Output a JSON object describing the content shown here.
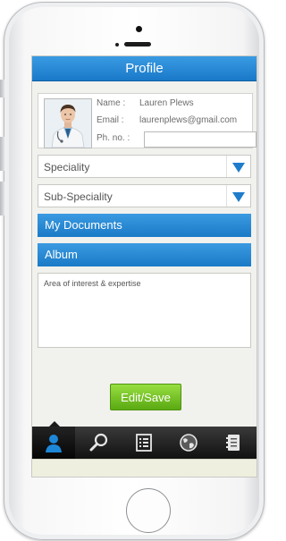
{
  "header": {
    "title": "Profile"
  },
  "profile": {
    "name_label": "Name :",
    "name_value": "Lauren Plews",
    "email_label": "Email :",
    "email_value": "laurenplews@gmail.com",
    "phone_label": "Ph. no. :",
    "phone_value": ""
  },
  "dropdowns": {
    "speciality": "Speciality",
    "sub_speciality": "Sub-Speciality"
  },
  "sections": {
    "documents": "My Documents",
    "album": "Album"
  },
  "interest": {
    "placeholder": "Area of interest & expertise"
  },
  "actions": {
    "edit_save": "Edit/Save"
  },
  "tabs": [
    {
      "icon": "person-icon",
      "active": true
    },
    {
      "icon": "search-icon",
      "active": false
    },
    {
      "icon": "list-icon",
      "active": false
    },
    {
      "icon": "globe-icon",
      "active": false
    },
    {
      "icon": "notebook-icon",
      "active": false
    }
  ],
  "colors": {
    "accent_blue": "#1a7ac7",
    "accent_green": "#6dbb1f",
    "tabbar_dark": "#111111",
    "active_icon": "#1e88d8"
  }
}
